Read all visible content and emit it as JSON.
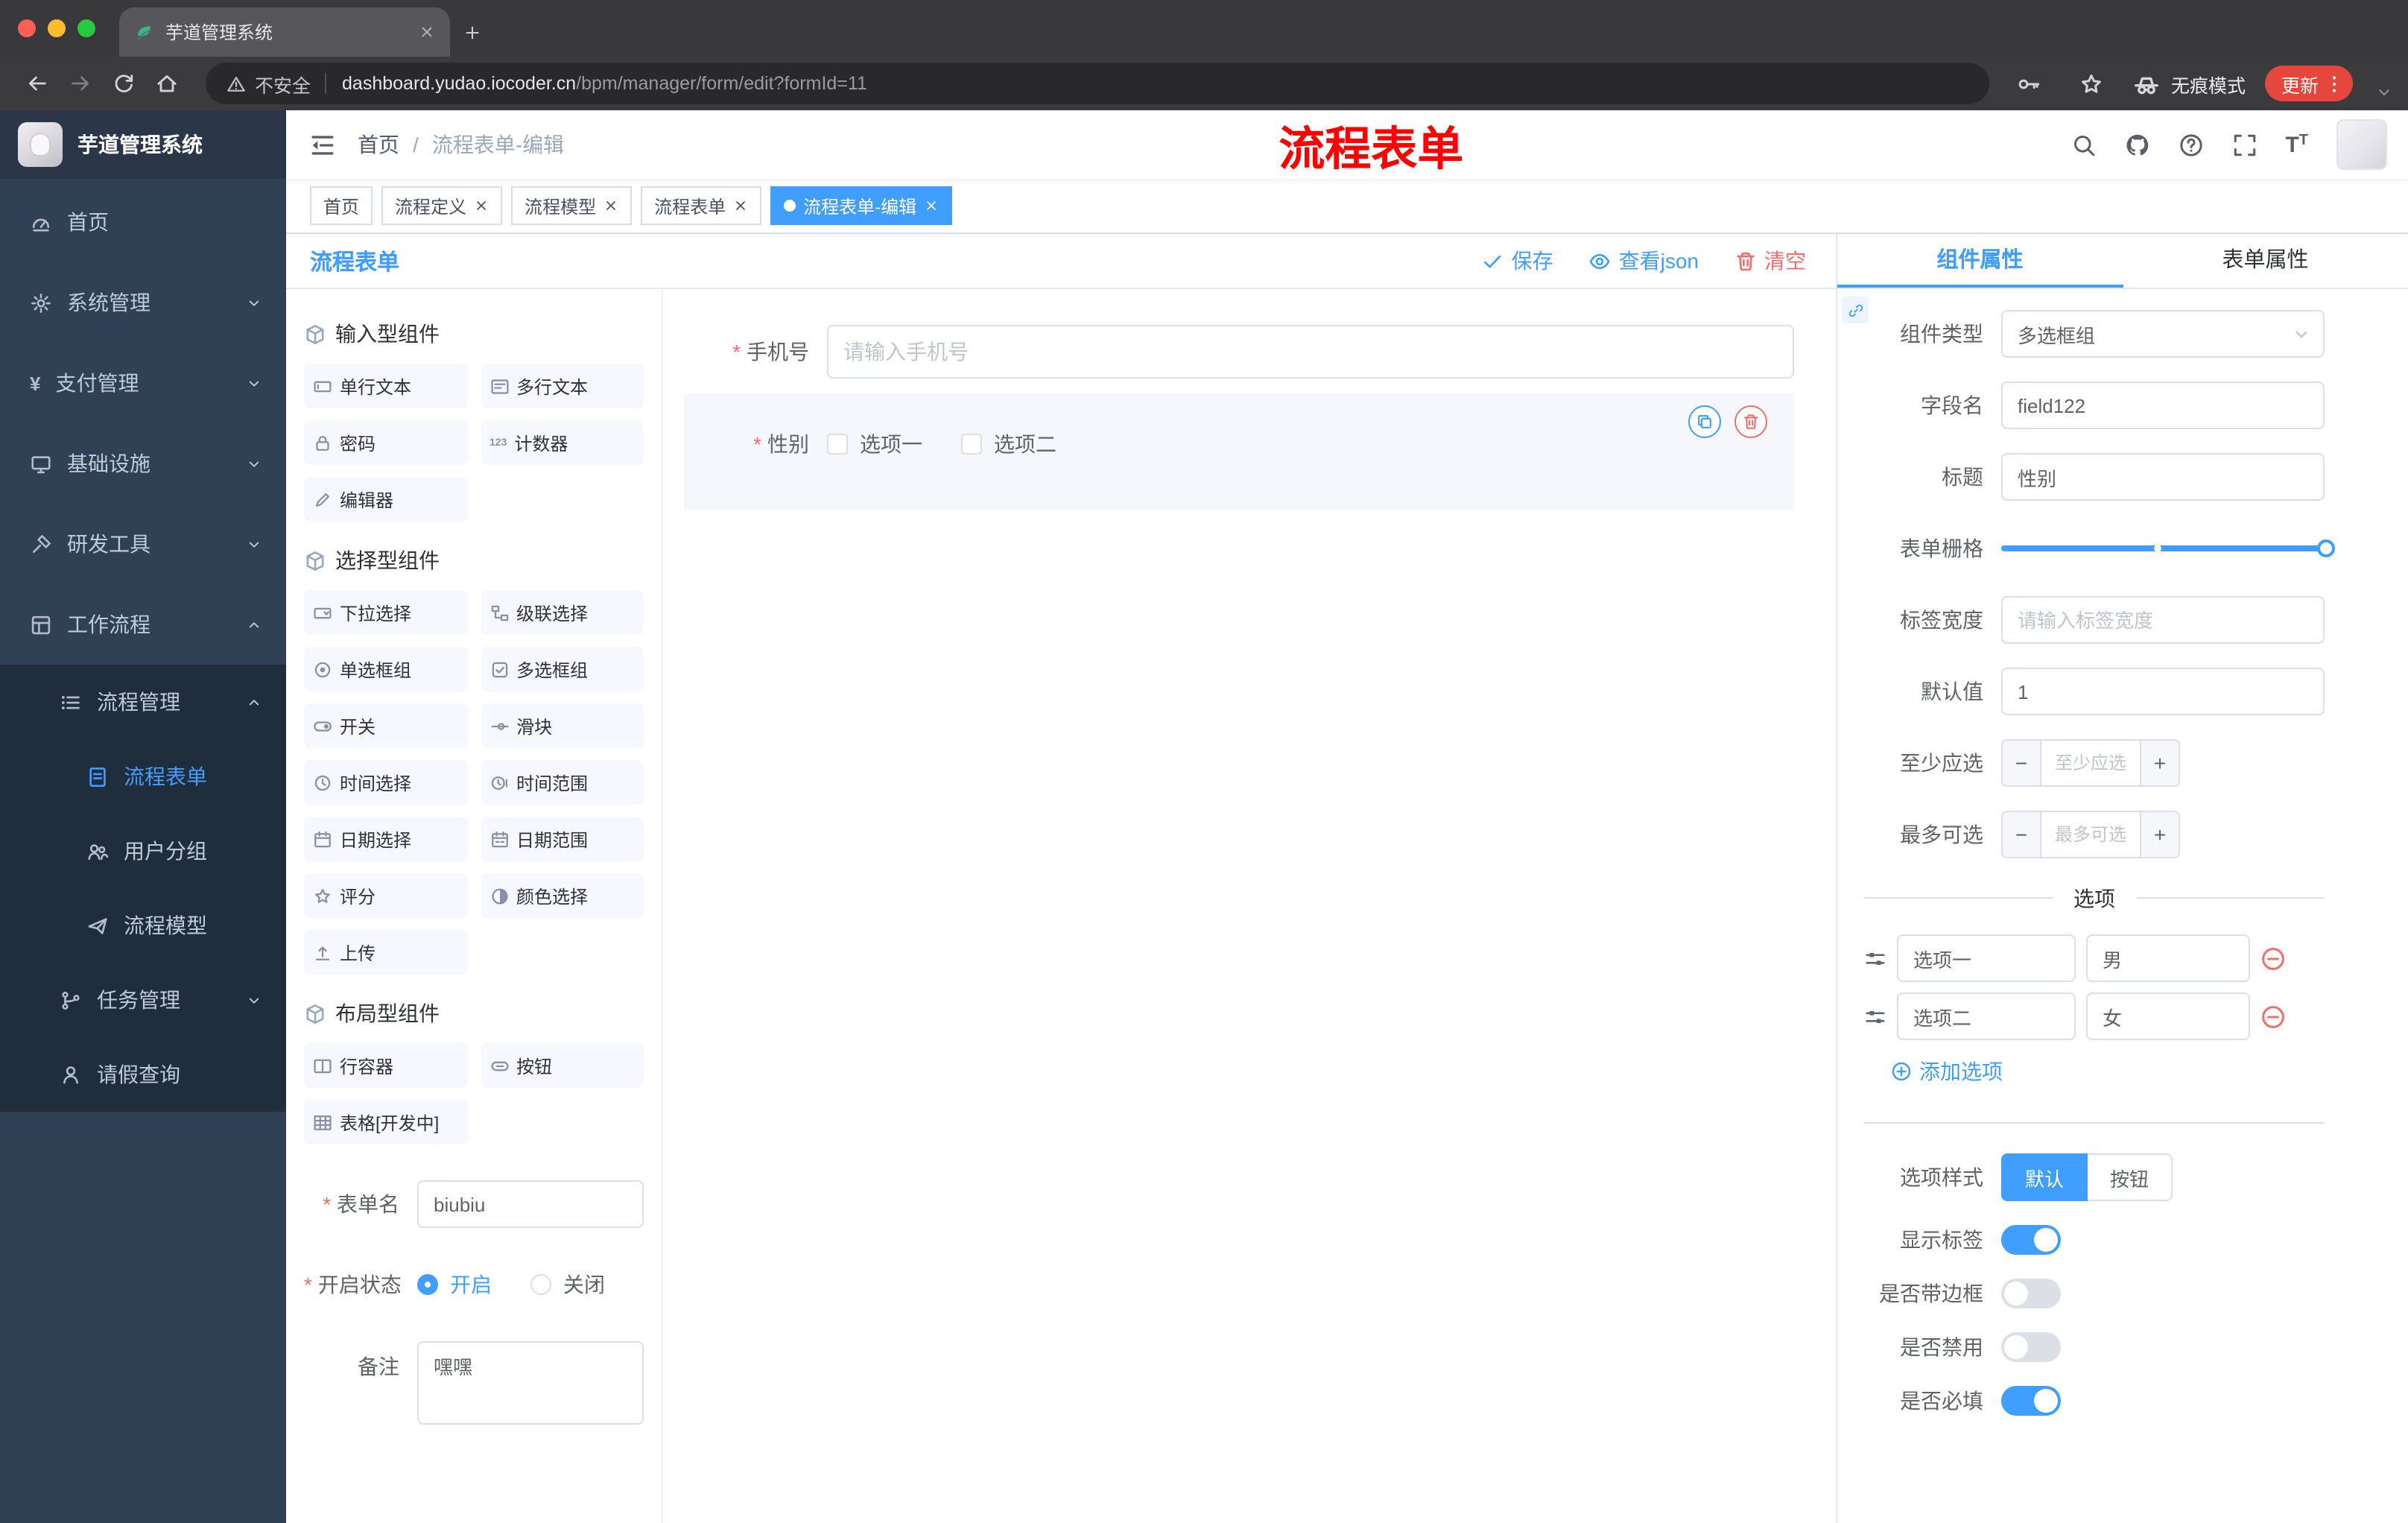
{
  "colors": {
    "accent": "#409EFF",
    "danger": "#F56C6C",
    "annotation": "#FF0000",
    "update_pill": "#E5473D",
    "sidebar_bg": "#304156",
    "submenu_bg": "#1f2d3d"
  },
  "browser": {
    "tab": {
      "title": "芋道管理系统"
    },
    "address": {
      "security": "不安全",
      "domain": "dashboard.yudao.iocoder.cn",
      "path": "/bpm/manager/form/edit?formId=11"
    },
    "incognito_label": "无痕模式",
    "update_label": "更新"
  },
  "sidebar": {
    "logo_title": "芋道管理系统",
    "menu": [
      {
        "id": "home",
        "label": "首页",
        "icon": "dashboard-icon",
        "symbol": "i-dash",
        "level": 1
      },
      {
        "id": "system",
        "label": "系统管理",
        "icon": "gear-icon",
        "symbol": "i-gear",
        "level": 1,
        "arrow": "down"
      },
      {
        "id": "payment",
        "label": "支付管理",
        "icon": "yen-icon",
        "symbol": "",
        "level": 1,
        "arrow": "down",
        "glyph": "¥"
      },
      {
        "id": "infrastructure",
        "label": "基础设施",
        "icon": "monitor-icon",
        "symbol": "i-monitor",
        "level": 1,
        "arrow": "down"
      },
      {
        "id": "dev-tools",
        "label": "研发工具",
        "icon": "tools-icon",
        "symbol": "i-hammer",
        "level": 1,
        "arrow": "down"
      },
      {
        "id": "workflow",
        "label": "工作流程",
        "icon": "workflow-icon",
        "symbol": "i-box",
        "level": 1,
        "arrow": "up"
      },
      {
        "id": "process-manage",
        "label": "流程管理",
        "icon": "process-list-icon",
        "symbol": "i-list",
        "level": 2,
        "arrow": "up",
        "sub": true
      },
      {
        "id": "process-form",
        "label": "流程表单",
        "icon": "form-document-icon",
        "symbol": "i-doc",
        "level": 3,
        "active": true,
        "sub": true
      },
      {
        "id": "user-group",
        "label": "用户分组",
        "icon": "user-group-icon",
        "symbol": "i-users",
        "level": 3,
        "sub": true
      },
      {
        "id": "process-model",
        "label": "流程模型",
        "icon": "paper-plane-icon",
        "symbol": "i-plane",
        "level": 3,
        "sub": true
      },
      {
        "id": "task-manage",
        "label": "任务管理",
        "icon": "branch-icon",
        "symbol": "i-branch",
        "level": 2,
        "arrow": "down",
        "sub": true
      },
      {
        "id": "leave-query",
        "label": "请假查询",
        "icon": "person-icon",
        "symbol": "i-user",
        "level": 2,
        "sub": true
      }
    ]
  },
  "header": {
    "breadcrumb": [
      "首页",
      "流程表单-编辑"
    ],
    "annotation": "流程表单"
  },
  "tags": [
    {
      "id": "home",
      "label": "首页",
      "closable": false,
      "active": false
    },
    {
      "id": "process-definition",
      "label": "流程定义",
      "closable": true,
      "active": false
    },
    {
      "id": "process-model",
      "label": "流程模型",
      "closable": true,
      "active": false
    },
    {
      "id": "process-form",
      "label": "流程表单",
      "closable": true,
      "active": false
    },
    {
      "id": "process-form-edit",
      "label": "流程表单-编辑",
      "closable": true,
      "active": true
    }
  ],
  "designer": {
    "title": "流程表单",
    "actions": {
      "save": "保存",
      "view_json": "查看json",
      "clear": "清空"
    },
    "palette": [
      {
        "id": "input-components",
        "title": "输入型组件",
        "items": [
          {
            "label": "单行文本",
            "icon": "single-line-icon",
            "symbol": "i-input"
          },
          {
            "label": "多行文本",
            "icon": "multi-line-icon",
            "symbol": "i-textarea"
          },
          {
            "label": "密码",
            "icon": "lock-icon",
            "symbol": "i-lock"
          },
          {
            "label": "计数器",
            "icon": "counter-icon",
            "symbol": "",
            "glyph": "123"
          },
          {
            "label": "编辑器",
            "icon": "editor-icon",
            "symbol": "i-edit"
          }
        ]
      },
      {
        "id": "select-components",
        "title": "选择型组件",
        "items": [
          {
            "label": "下拉选择",
            "icon": "select-icon",
            "symbol": "i-select"
          },
          {
            "label": "级联选择",
            "icon": "cascader-icon",
            "symbol": "i-cascader"
          },
          {
            "label": "单选框组",
            "icon": "radio-group-icon",
            "symbol": "i-radio"
          },
          {
            "label": "多选框组",
            "icon": "checkbox-group-icon",
            "symbol": "i-checkbox"
          },
          {
            "label": "开关",
            "icon": "switch-icon",
            "symbol": "i-switch"
          },
          {
            "label": "滑块",
            "icon": "slider-icon",
            "symbol": "i-sliderh"
          },
          {
            "label": "时间选择",
            "icon": "time-icon",
            "symbol": "i-time"
          },
          {
            "label": "时间范围",
            "icon": "time-range-icon",
            "symbol": "i-time2"
          },
          {
            "label": "日期选择",
            "icon": "date-icon",
            "symbol": "i-date"
          },
          {
            "label": "日期范围",
            "icon": "date-range-icon",
            "symbol": "i-date2"
          },
          {
            "label": "评分",
            "icon": "rate-star-icon",
            "symbol": "i-star"
          },
          {
            "label": "颜色选择",
            "icon": "color-picker-icon",
            "symbol": "i-color"
          },
          {
            "label": "上传",
            "icon": "upload-icon",
            "symbol": "i-upload"
          }
        ]
      },
      {
        "id": "layout-components",
        "title": "布局型组件",
        "items": [
          {
            "label": "行容器",
            "icon": "row-container-icon",
            "symbol": "i-row"
          },
          {
            "label": "按钮",
            "icon": "button-icon",
            "symbol": "i-btn"
          },
          {
            "label": "表格[开发中]",
            "icon": "table-icon",
            "symbol": "i-table"
          }
        ]
      }
    ],
    "meta": {
      "form_name": {
        "label": "表单名",
        "value": "biubiu",
        "required": true
      },
      "status": {
        "label": "开启状态",
        "required": true,
        "options": [
          {
            "label": "开启",
            "checked": true
          },
          {
            "label": "关闭",
            "checked": false
          }
        ]
      },
      "remark": {
        "label": "备注",
        "value": "嘿嘿"
      }
    },
    "canvas": {
      "phone": {
        "label": "手机号",
        "placeholder": "请输入手机号",
        "required": true
      },
      "gender": {
        "label": "性别",
        "required": true,
        "options": [
          "选项一",
          "选项二"
        ]
      }
    }
  },
  "properties": {
    "tabs": [
      {
        "label": "组件属性",
        "active": true
      },
      {
        "label": "表单属性",
        "active": false
      }
    ],
    "component_type": {
      "label": "组件类型",
      "value": "多选框组"
    },
    "field_name": {
      "label": "字段名",
      "value": "field122"
    },
    "title_field": {
      "label": "标题",
      "value": "性别"
    },
    "grid": {
      "label": "表单栅格",
      "value_position": "max",
      "stop_position_pct": 48.5
    },
    "label_width": {
      "label": "标签宽度",
      "placeholder": "请输入标签宽度"
    },
    "default_value": {
      "label": "默认值",
      "value": "1"
    },
    "min_select": {
      "label": "至少应选",
      "placeholder": "至少应选"
    },
    "max_select": {
      "label": "最多可选",
      "placeholder": "最多可选"
    },
    "options_title": "选项",
    "options": [
      {
        "label": "选项一",
        "value": "男"
      },
      {
        "label": "选项二",
        "value": "女"
      }
    ],
    "add_option": "添加选项",
    "option_style": {
      "label": "选项样式",
      "choices": [
        {
          "label": "默认",
          "active": true
        },
        {
          "label": "按钮",
          "active": false
        }
      ]
    },
    "switches": [
      {
        "id": "show-label",
        "label": "显示标签",
        "on": true
      },
      {
        "id": "with-border",
        "label": "是否带边框",
        "on": false
      },
      {
        "id": "disabled",
        "label": "是否禁用",
        "on": false
      },
      {
        "id": "required",
        "label": "是否必填",
        "on": true
      }
    ]
  }
}
